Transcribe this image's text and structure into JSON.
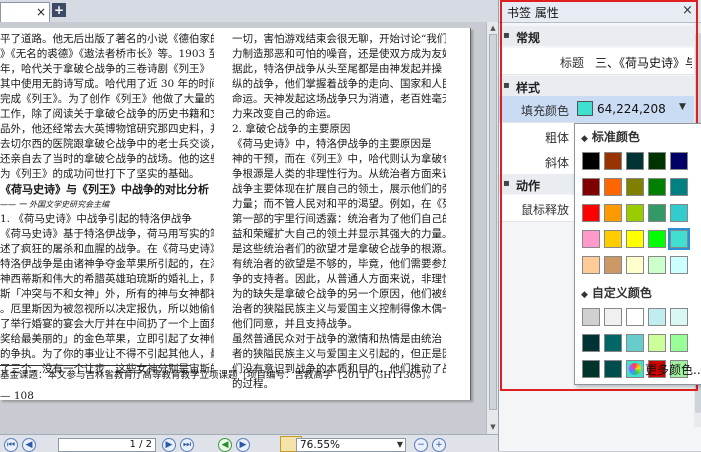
{
  "tab": {
    "label": "",
    "close_glyph": "×",
    "add_glyph": "+"
  },
  "document": {
    "left_lines": [
      "平了道路。他无后出版了著名的小说《德伯家的",
      "》《无名的裘德》《遨法者桥市长》等。1903 至",
      "年，哈代关于拿破仑战争的三卷诗剧《列王》",
      "其中使用无韵诗写成。哈代用了近 30 年的时间从计",
      "完成《列王》。为了创作《列王》他做了大量的",
      "工作，除了阅读关于拿破仑战争的历史书籍和文",
      "品外，他还经常去大英博物馆研究那四史料，并",
      "去切尔西的医院跟拿破仑战争中的老士兵交谈，",
      "还亲自去了当时的拿破仑战争的战场。他的这些",
      "为《列王》的成功问世打下了坚实的基础。"
    ],
    "left_heading": "《荷马史诗》与《列王》中战争的对比分析",
    "left_subnote": "——  一  外国文学史研究会主编",
    "left_lines2": [
      "1.   《荷马史诗》中战争引起的特洛伊战争",
      "《荷马史诗》基于特洛伊战争，荷马用写实的笔",
      "述了疯狂的屠杀和血腥的战争。在《荷马史诗》",
      "特洛伊战争是由诸神争夺金苹果所引起的，在海",
      "神西蒂斯和伟大的希腊英雄珀琉斯的婚礼上，除",
      "斯「冲突与不和女神」外，所有的神与女神都被",
      "。厄里斯因为被忽视所以决定报仇，所以她偷偷",
      "了举行婚宴的宴会大厅并在中间扔了一个上面刻",
      "奖给最美丽的」的金色苹果，立即引起了女神们",
      "的争执。为了你的事业让不得不引起其他人，最后，",
      "了三个，没有一个让步。这些女神分别是宙斯的"
    ],
    "right_lines": [
      "一切，害怕游戏结束会很无聊，开始讨论“我们要努",
      "力制造那恶和可怕的噪音，还是使双方成为友好”",
      "    据此，特洛伊战争从头至尾都是由神发起并操",
      "纵的战争，他们掌握着战争的走向、国家和人民的",
      "命运。天神发起这场战争只为消遣，老百姓毫无能",
      "力来改变自己的命运。",
      "    2. 拿破仑战争的主要原因",
      "    《荷马史诗》中，特洛伊战争的主要原因是",
      "神的干预，而在《列王》中，哈代则认为拿破仑战",
      "争根源是人类的非理性行为。从统治者方面来说，",
      "战争主要体现在扩展自己的领土，展示他们的强大",
      "力量；而不管人民对和平的渴望。例如，在《列王》",
      "第一部的宇里行间透露：统治者为了他们自己的利",
      "益和荣耀扩大自己的领土并显示其强大的力量。正",
      "是这些统治者们的欲望才是拿破仑战争的根源。只",
      "有统治者的欲望是不够的，毕竟，他们需要参加战",
      "争的支持者。因此，从普通人方面来说，非理性行",
      "为的缺失是拿破仑战争的另一个原因，他们被统",
      "治者的狭隘民族主义与爱国主义控制得像木偶一样。",
      "他们同意，并且支持战争。",
      "    虽然普通民众对于战争的激情和热情是由统治",
      "者的狭隘民族主义与爱国主义引起的，但正是因为他",
      "们没有意识到战争的本质和目的，他们推动了战争",
      "的过程。"
    ],
    "footnote": "基金课题：本文参与吉林省教育厅高等教育教学立项课题［项目编号：吉教高字［2011］GH11365］。",
    "page_number": "— 108"
  },
  "statusbar": {
    "page_value": "1 / 2",
    "zoom_value": "76.55%"
  },
  "panel": {
    "title": "书签 属性",
    "close_glyph": "×",
    "groups": {
      "general": "常规",
      "style": "样式",
      "action": "动作"
    },
    "rows": {
      "title_label": "标题",
      "title_value": "三、《荷马史诗》与...",
      "fill_label": "填充颜色",
      "fill_value": "64,224,208",
      "fill_color": "#40e0d0",
      "bold_label": "粗体",
      "italic_label": "斜体",
      "mouse_label": "鼠标释放"
    }
  },
  "color_popup": {
    "standard_title": "标准颜色",
    "custom_title": "自定义颜色",
    "more_label": "更多颜色...",
    "standard_colors": [
      [
        "#000000",
        "#993300",
        "#003333",
        "#003300",
        "#000066"
      ],
      [
        "#800000",
        "#ff6600",
        "#808000",
        "#008000",
        "#008080"
      ],
      [
        "#ff0000",
        "#ff9900",
        "#99cc00",
        "#339966",
        "#33cccc"
      ],
      [
        "#ff99cc",
        "#ffcc00",
        "#ffff00",
        "#00ff00",
        "#40e0d0"
      ],
      [
        "#ffcc99",
        "#cc9966",
        "#ffffcc",
        "#ccffcc",
        "#ccffff"
      ]
    ],
    "custom_colors": [
      [
        "#d0d0d0",
        "#f0f0f0",
        "#ffffff",
        "#c0eef0",
        "#d9f7f3"
      ],
      [
        "#003333",
        "#006666",
        "#66cccc",
        "#ccff99",
        "#99ff99"
      ],
      [
        "#00332a",
        "#004d4d",
        "#40e0d0",
        "#cc0000",
        "#a0f0a0"
      ]
    ],
    "selected": "#40e0d0"
  }
}
